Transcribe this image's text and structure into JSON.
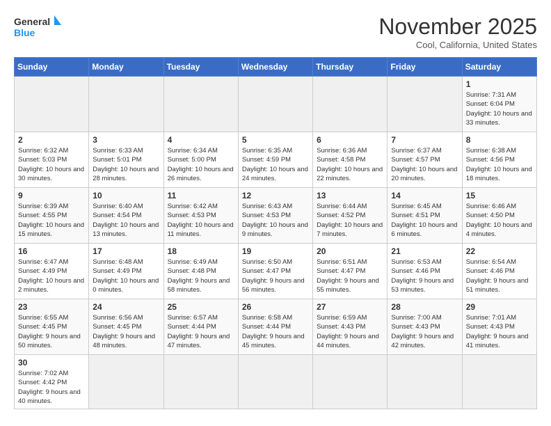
{
  "header": {
    "logo_general": "General",
    "logo_blue": "Blue",
    "month_title": "November 2025",
    "location": "Cool, California, United States"
  },
  "days_of_week": [
    "Sunday",
    "Monday",
    "Tuesday",
    "Wednesday",
    "Thursday",
    "Friday",
    "Saturday"
  ],
  "weeks": [
    [
      {
        "day": "",
        "content": ""
      },
      {
        "day": "",
        "content": ""
      },
      {
        "day": "",
        "content": ""
      },
      {
        "day": "",
        "content": ""
      },
      {
        "day": "",
        "content": ""
      },
      {
        "day": "",
        "content": ""
      },
      {
        "day": "1",
        "content": "Sunrise: 7:31 AM\nSunset: 6:04 PM\nDaylight: 10 hours\nand 33 minutes."
      }
    ],
    [
      {
        "day": "2",
        "content": "Sunrise: 6:32 AM\nSunset: 5:03 PM\nDaylight: 10 hours\nand 30 minutes."
      },
      {
        "day": "3",
        "content": "Sunrise: 6:33 AM\nSunset: 5:01 PM\nDaylight: 10 hours\nand 28 minutes."
      },
      {
        "day": "4",
        "content": "Sunrise: 6:34 AM\nSunset: 5:00 PM\nDaylight: 10 hours\nand 26 minutes."
      },
      {
        "day": "5",
        "content": "Sunrise: 6:35 AM\nSunset: 4:59 PM\nDaylight: 10 hours\nand 24 minutes."
      },
      {
        "day": "6",
        "content": "Sunrise: 6:36 AM\nSunset: 4:58 PM\nDaylight: 10 hours\nand 22 minutes."
      },
      {
        "day": "7",
        "content": "Sunrise: 6:37 AM\nSunset: 4:57 PM\nDaylight: 10 hours\nand 20 minutes."
      },
      {
        "day": "8",
        "content": "Sunrise: 6:38 AM\nSunset: 4:56 PM\nDaylight: 10 hours\nand 18 minutes."
      }
    ],
    [
      {
        "day": "9",
        "content": "Sunrise: 6:39 AM\nSunset: 4:55 PM\nDaylight: 10 hours\nand 15 minutes."
      },
      {
        "day": "10",
        "content": "Sunrise: 6:40 AM\nSunset: 4:54 PM\nDaylight: 10 hours\nand 13 minutes."
      },
      {
        "day": "11",
        "content": "Sunrise: 6:42 AM\nSunset: 4:53 PM\nDaylight: 10 hours\nand 11 minutes."
      },
      {
        "day": "12",
        "content": "Sunrise: 6:43 AM\nSunset: 4:53 PM\nDaylight: 10 hours\nand 9 minutes."
      },
      {
        "day": "13",
        "content": "Sunrise: 6:44 AM\nSunset: 4:52 PM\nDaylight: 10 hours\nand 7 minutes."
      },
      {
        "day": "14",
        "content": "Sunrise: 6:45 AM\nSunset: 4:51 PM\nDaylight: 10 hours\nand 6 minutes."
      },
      {
        "day": "15",
        "content": "Sunrise: 6:46 AM\nSunset: 4:50 PM\nDaylight: 10 hours\nand 4 minutes."
      }
    ],
    [
      {
        "day": "16",
        "content": "Sunrise: 6:47 AM\nSunset: 4:49 PM\nDaylight: 10 hours\nand 2 minutes."
      },
      {
        "day": "17",
        "content": "Sunrise: 6:48 AM\nSunset: 4:49 PM\nDaylight: 10 hours\nand 0 minutes."
      },
      {
        "day": "18",
        "content": "Sunrise: 6:49 AM\nSunset: 4:48 PM\nDaylight: 9 hours\nand 58 minutes."
      },
      {
        "day": "19",
        "content": "Sunrise: 6:50 AM\nSunset: 4:47 PM\nDaylight: 9 hours\nand 56 minutes."
      },
      {
        "day": "20",
        "content": "Sunrise: 6:51 AM\nSunset: 4:47 PM\nDaylight: 9 hours\nand 55 minutes."
      },
      {
        "day": "21",
        "content": "Sunrise: 6:53 AM\nSunset: 4:46 PM\nDaylight: 9 hours\nand 53 minutes."
      },
      {
        "day": "22",
        "content": "Sunrise: 6:54 AM\nSunset: 4:46 PM\nDaylight: 9 hours\nand 51 minutes."
      }
    ],
    [
      {
        "day": "23",
        "content": "Sunrise: 6:55 AM\nSunset: 4:45 PM\nDaylight: 9 hours\nand 50 minutes."
      },
      {
        "day": "24",
        "content": "Sunrise: 6:56 AM\nSunset: 4:45 PM\nDaylight: 9 hours\nand 48 minutes."
      },
      {
        "day": "25",
        "content": "Sunrise: 6:57 AM\nSunset: 4:44 PM\nDaylight: 9 hours\nand 47 minutes."
      },
      {
        "day": "26",
        "content": "Sunrise: 6:58 AM\nSunset: 4:44 PM\nDaylight: 9 hours\nand 45 minutes."
      },
      {
        "day": "27",
        "content": "Sunrise: 6:59 AM\nSunset: 4:43 PM\nDaylight: 9 hours\nand 44 minutes."
      },
      {
        "day": "28",
        "content": "Sunrise: 7:00 AM\nSunset: 4:43 PM\nDaylight: 9 hours\nand 42 minutes."
      },
      {
        "day": "29",
        "content": "Sunrise: 7:01 AM\nSunset: 4:43 PM\nDaylight: 9 hours\nand 41 minutes."
      }
    ],
    [
      {
        "day": "30",
        "content": "Sunrise: 7:02 AM\nSunset: 4:42 PM\nDaylight: 9 hours\nand 40 minutes."
      },
      {
        "day": "",
        "content": ""
      },
      {
        "day": "",
        "content": ""
      },
      {
        "day": "",
        "content": ""
      },
      {
        "day": "",
        "content": ""
      },
      {
        "day": "",
        "content": ""
      },
      {
        "day": "",
        "content": ""
      }
    ]
  ]
}
